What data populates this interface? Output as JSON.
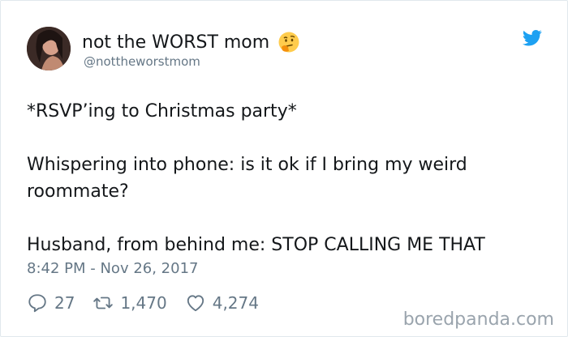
{
  "user": {
    "display_name": "not the WORST mom",
    "handle": "@nottheworstmom",
    "emoji_icon": "thinking-face-icon",
    "verified_brand_icon": "twitter-bird-icon"
  },
  "tweet": {
    "lines": [
      "*RSVP’ing to Christmas party*",
      "Whispering into phone: is it ok if I bring my weird roommate?",
      "Husband, from behind me: STOP CALLING ME THAT"
    ],
    "timestamp": "8:42 PM - Nov 26, 2017"
  },
  "actions": {
    "replies": "27",
    "retweets": "1,470",
    "likes": "4,274"
  },
  "watermark": "boredpanda.com",
  "colors": {
    "text": "#14171a",
    "secondary": "#657786",
    "twitter_blue": "#1da1f2",
    "border": "#e1e8ed"
  }
}
